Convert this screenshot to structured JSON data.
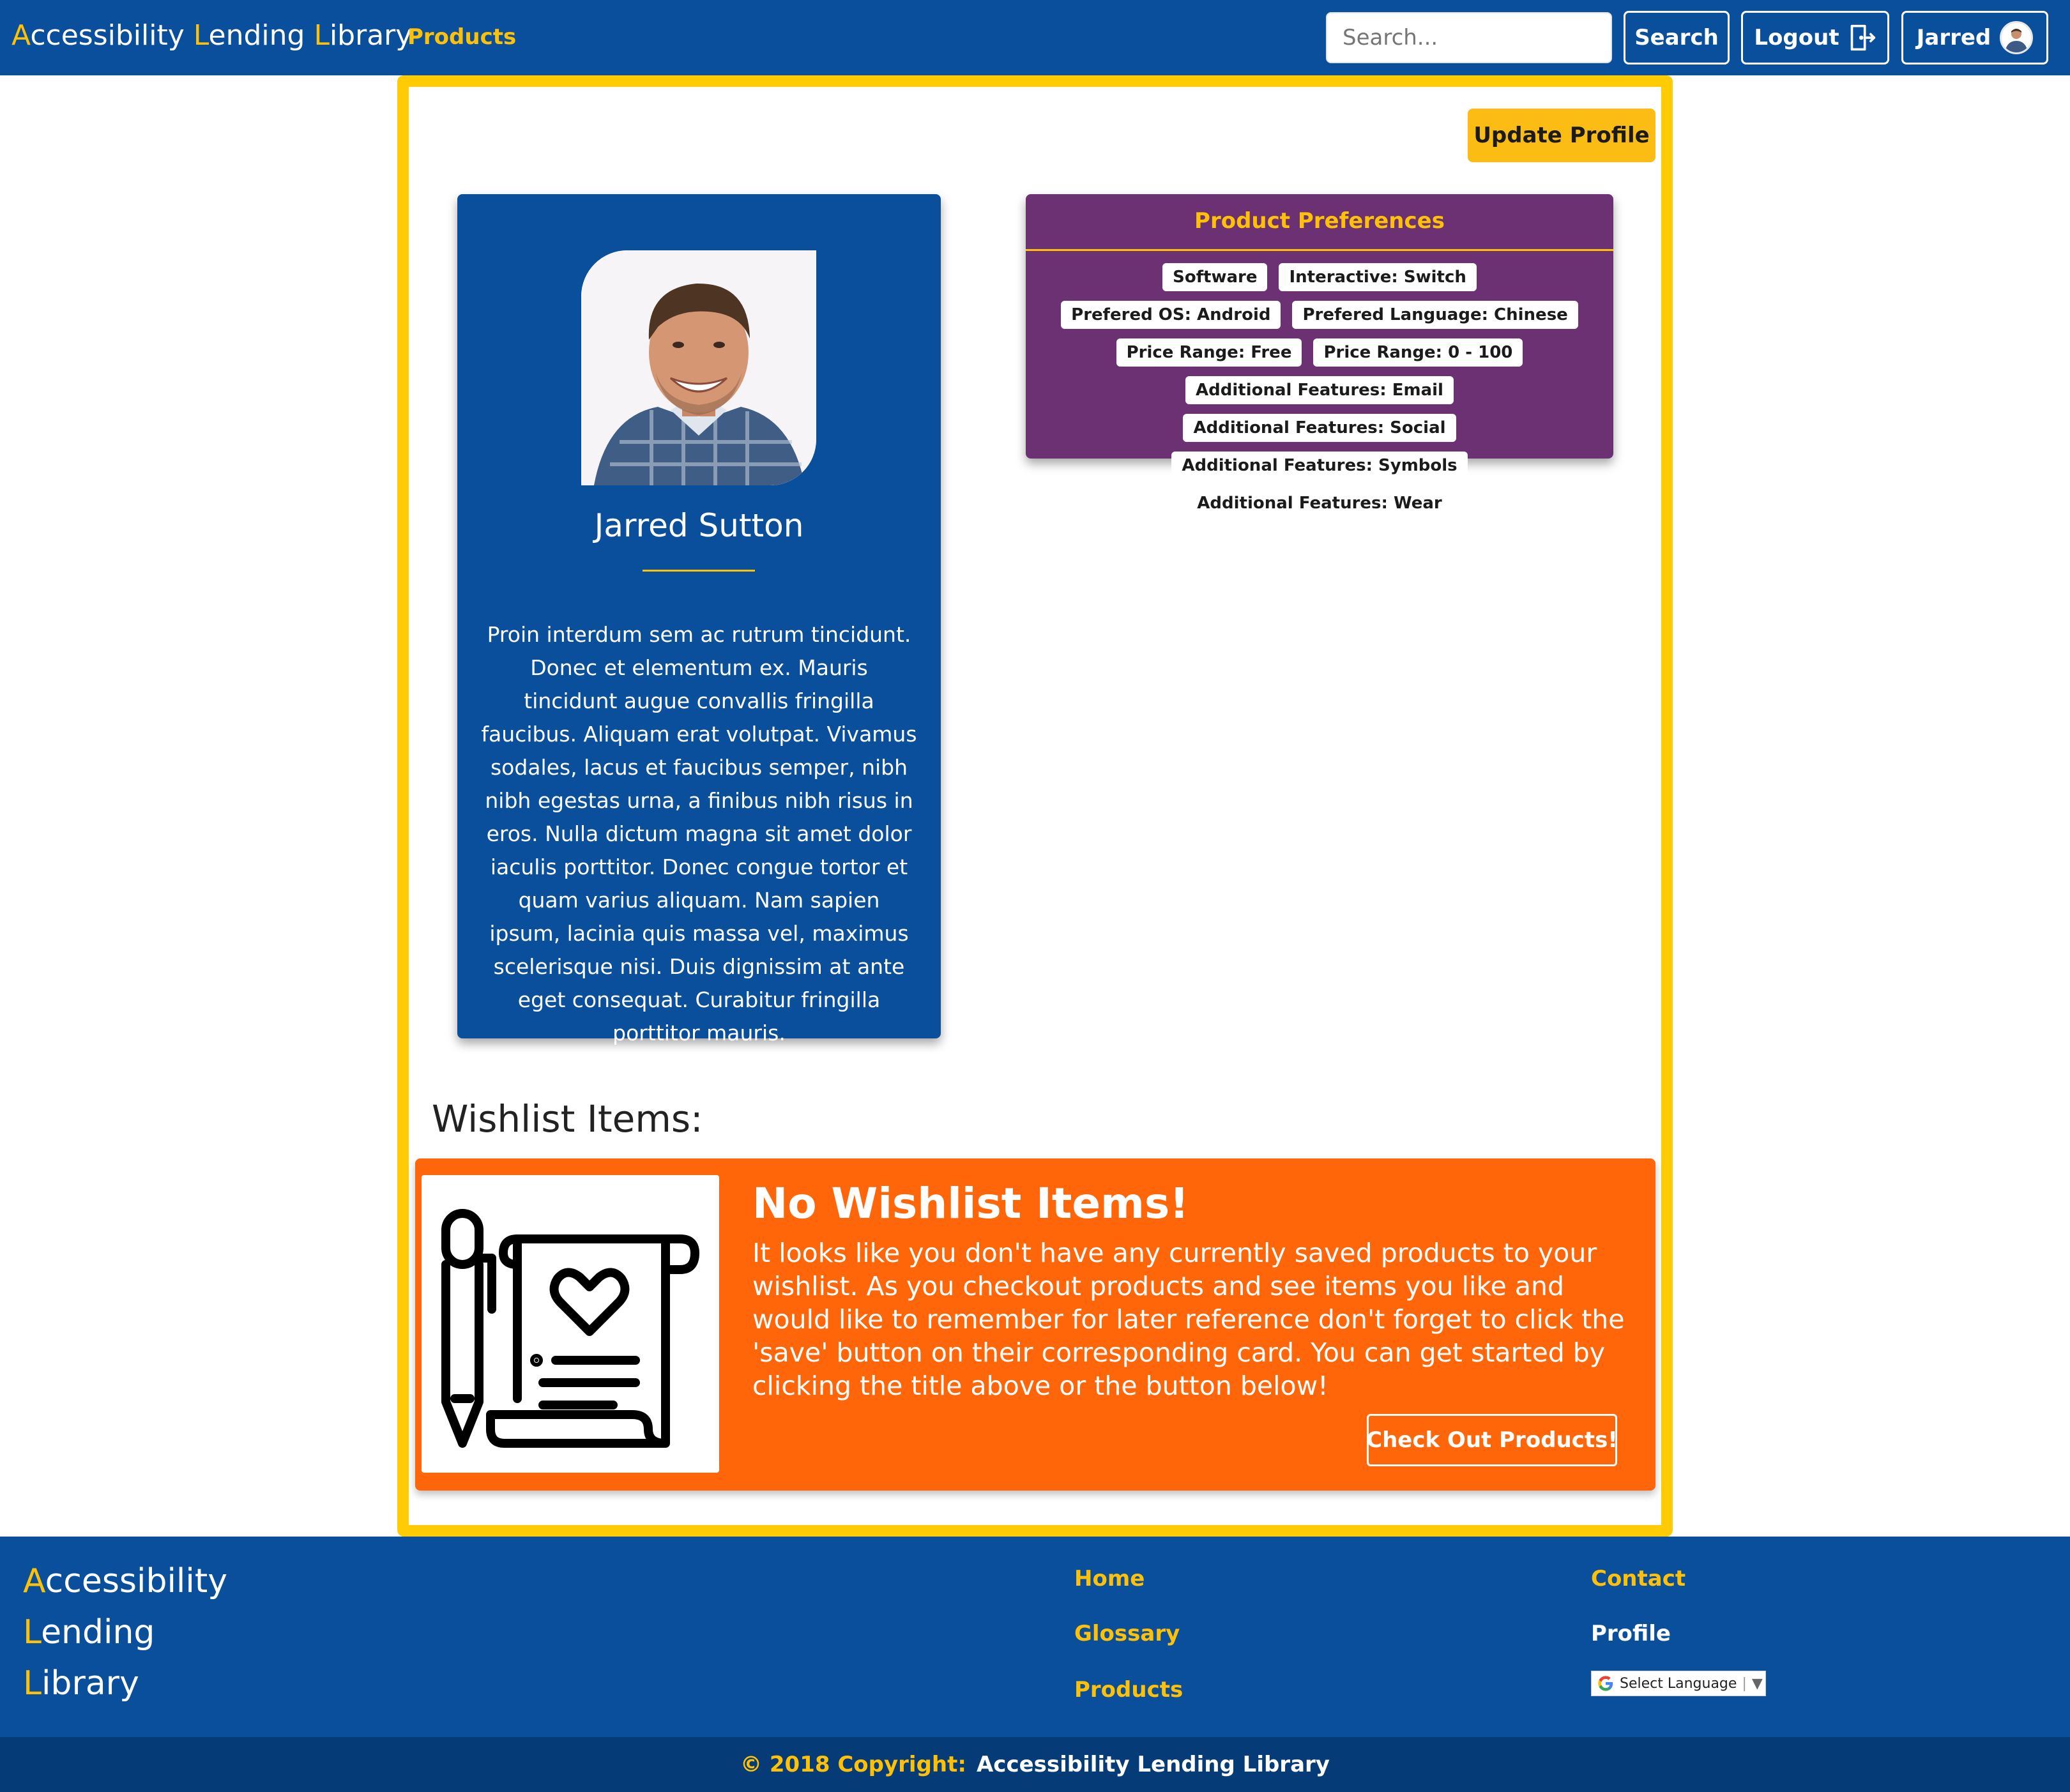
{
  "navbar": {
    "brand_parts": [
      {
        "initial": "A",
        "rest": "ccessibility"
      },
      {
        "initial": "L",
        "rest": "ending"
      },
      {
        "initial": "L",
        "rest": "ibrary"
      }
    ],
    "products_label": "Products",
    "search_placeholder": "Search...",
    "search_button": "Search",
    "logout_button": "Logout",
    "user_button": "Jarred"
  },
  "profile": {
    "update_button": "Update Profile",
    "name": "Jarred Sutton",
    "bio": "Proin interdum sem ac rutrum tincidunt. Donec et elementum ex. Mauris tincidunt augue convallis fringilla faucibus. Aliquam erat volutpat. Vivamus sodales, lacus et faucibus semper, nibh nibh egestas urna, a finibus nibh risus in eros. Nulla dictum magna sit amet dolor iaculis porttitor. Donec congue tortor et quam varius aliquam. Nam sapien ipsum, lacinia quis massa vel, maximus scelerisque nisi. Duis dignissim at ante eget consequat. Curabitur fringilla porttitor mauris."
  },
  "preferences": {
    "title": "Product Preferences",
    "tags": [
      "Software",
      "Interactive: Switch",
      "Prefered OS: Android",
      "Prefered Language: Chinese",
      "Price Range: Free",
      "Price Range: 0 - 100",
      "Additional Features: Email",
      "Additional Features: Social",
      "Additional Features: Symbols",
      "Additional Features: Wear"
    ]
  },
  "wishlist": {
    "heading": "Wishlist Items:",
    "empty_title": "No Wishlist Items!",
    "empty_text": "It looks like you don't have any currently saved products to your wishlist. As you checkout products and see items you like and would like to remember for later reference don't forget to click the 'save' button on their corresponding card. You can get started by clicking the title above or the button below!",
    "cta_button": "Check Out Products!"
  },
  "footer": {
    "brand_parts": [
      {
        "initial": "A",
        "rest": "ccessibility"
      },
      {
        "initial": "L",
        "rest": "ending"
      },
      {
        "initial": "L",
        "rest": "ibrary"
      }
    ],
    "links": {
      "home": "Home",
      "glossary": "Glossary",
      "products": "Products",
      "contact": "Contact",
      "profile": "Profile"
    },
    "language_select": "Select Language",
    "copyright_prefix": "© 2018 Copyright:",
    "copyright_owner": "Accessibility Lending Library"
  },
  "colors": {
    "primary_blue": "#0a4f9c",
    "accent_gold": "#ffc107",
    "frame_yellow": "#ffcb05",
    "preferences_purple": "#6c3173",
    "wishlist_orange": "#ff6609",
    "footer_dark": "#053b76"
  },
  "icons": {
    "logout": "logout-door-icon",
    "user": "user-avatar",
    "wishlist": "pen-and-scroll-heart-icon",
    "language": "google-g-icon"
  }
}
